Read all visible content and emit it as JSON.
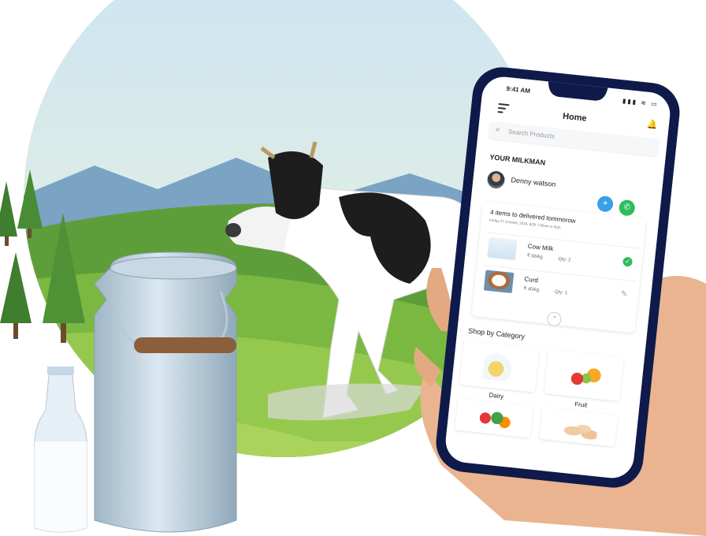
{
  "status_bar": {
    "time": "9:41 AM",
    "icons": "▮▮▮ ≋ ▭"
  },
  "header": {
    "title": "Home"
  },
  "search": {
    "placeholder": "Search Products"
  },
  "milkman": {
    "heading": "YOUR MILKMAN",
    "name": "Denny watson"
  },
  "delivery": {
    "title": "4 items to delivered tommorow",
    "subtitle": "Friday 27 October, 2018, 8/26 7:00am to 5pm",
    "items": [
      {
        "name": "Cow Milk",
        "price": "₹ 56/kg",
        "qty": "Qty: 2",
        "status": "delivered"
      },
      {
        "name": "Curd",
        "price": "₹ 40/kg",
        "qty": "Qty: 1",
        "status": "editable"
      }
    ]
  },
  "categories": {
    "heading": "Shop by Category",
    "items": [
      {
        "label": "Dairy"
      },
      {
        "label": "Fruit"
      },
      {
        "label": ""
      },
      {
        "label": ""
      }
    ]
  },
  "colors": {
    "accent_green": "#2ebd59",
    "accent_blue": "#3aa0e6",
    "phone_frame": "#0f1a4a",
    "bell": "#e53935"
  }
}
